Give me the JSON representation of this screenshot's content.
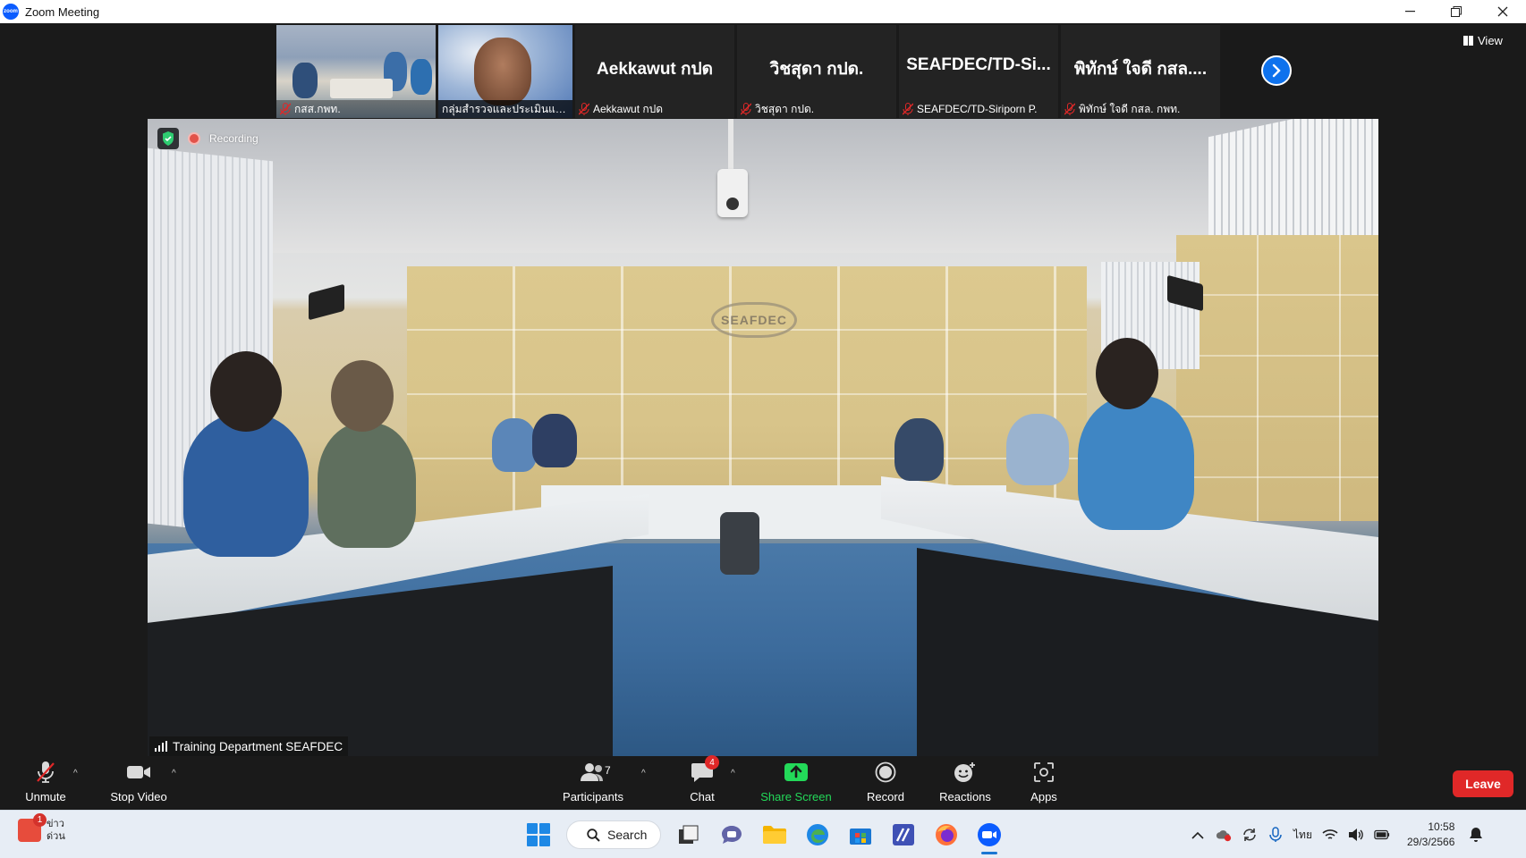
{
  "window": {
    "title": "Zoom Meeting",
    "controls": [
      "minimize",
      "restore",
      "close"
    ]
  },
  "gallery": {
    "thumbnails": [
      {
        "type": "video",
        "caption": "กสส.กพท.",
        "muted": true
      },
      {
        "type": "video",
        "caption": "กลุ่มสำรวจและประเมินแหล่งปร...",
        "muted": false
      },
      {
        "type": "name",
        "display_name": "Aekkawut กปด",
        "caption": "Aekkawut กปด",
        "muted": true
      },
      {
        "type": "name",
        "display_name": "วิชสุดา กปด.",
        "caption": "วิชสุดา กปด.",
        "muted": true
      },
      {
        "type": "name",
        "display_name": "SEAFDEC/TD-Si...",
        "caption": "SEAFDEC/TD-Siriporn P.",
        "muted": true
      },
      {
        "type": "name",
        "display_name": "พิทักษ์ ใจดี กสล....",
        "caption": "พิทักษ์ ใจดี กสล. กพท.",
        "muted": true
      }
    ],
    "next_icon": "chevron-right-icon",
    "view_label": "View"
  },
  "main_video": {
    "recording_label": "Recording",
    "speaker_name": "Training Department SEAFDEC",
    "wall_logo": "SEAFDEC"
  },
  "toolbar": {
    "unmute_label": "Unmute",
    "stop_video_label": "Stop Video",
    "participants_label": "Participants",
    "participants_count": "7",
    "chat_label": "Chat",
    "chat_badge": "4",
    "share_label": "Share Screen",
    "record_label": "Record",
    "reactions_label": "Reactions",
    "apps_label": "Apps",
    "leave_label": "Leave",
    "share_color": "#23d959",
    "leave_color": "#e02828"
  },
  "taskbar": {
    "news_badge": "1",
    "news_line1": "ข่าว",
    "news_line2": "ด่วน",
    "search_label": "Search",
    "language": "ไทย",
    "time": "10:58",
    "date": "29/3/2566"
  }
}
